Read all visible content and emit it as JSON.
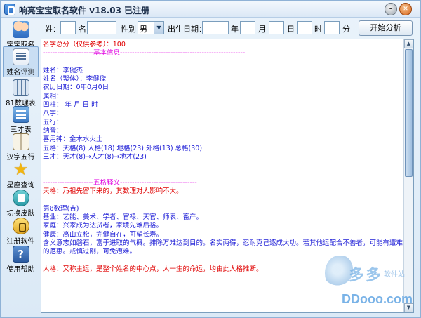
{
  "window": {
    "title": "响亮宝宝取名软件  v18.03   已注册",
    "minimize_glyph": "–",
    "close_glyph": "✕"
  },
  "sidebar": {
    "items": [
      {
        "label": "宝宝取名",
        "icon": "baby-icon"
      },
      {
        "label": "姓名评测",
        "icon": "name-eval-icon",
        "active": true
      },
      {
        "label": "81数理表",
        "icon": "grid-table-icon"
      },
      {
        "label": "三才表",
        "icon": "sancai-table-icon"
      },
      {
        "label": "汉字五行",
        "icon": "book-icon"
      },
      {
        "label": "星座查询",
        "icon": "star-icon"
      },
      {
        "label": "切换皮肤",
        "icon": "tshirt-icon"
      },
      {
        "label": "注册软件",
        "icon": "key-icon"
      },
      {
        "label": "使用帮助",
        "icon": "help-icon"
      }
    ]
  },
  "form": {
    "surname_label": "姓：",
    "surname_value": "",
    "given_label": "名",
    "given_value": "",
    "gender_label": "性别",
    "gender_value": "男",
    "birthdate_label": "出生日期：",
    "year_label": "年",
    "month_label": "月",
    "day_label": "日",
    "hour_label": "时",
    "minute_label": "分",
    "analyze_button": "开始分析"
  },
  "result": {
    "score_line": "名字总分（仅供参考）：100",
    "basic_header": "---------------------基本信息----------------------------------------------------",
    "name_simplified": "姓名：李健杰",
    "name_traditional": "姓名（繁体）：李健傑",
    "lunar_date": "农历日期：0年0月0日",
    "zodiac": "属相：",
    "four_pillars": "四柱： 年  月  日  时",
    "bazi": "八字：",
    "wuxing": "五行：",
    "nayin": "纳音：",
    "xiyongshen": "喜用神：金木水火土",
    "wuge": "五格：天格(8)  人格(18)  地格(23)  外格(13)  总格(30)",
    "sancai": "三才：天才(8)→人才(8)→地才(23)",
    "wuge_header": "---------------------五格释义--------------------------------",
    "tiange_explain": "天格：乃祖先留下来的，其数理对人影响不大。",
    "shuli_title": "第8数理(吉)",
    "jiye": "基业：艺能、美术、学者、官禄、天官、师表、畜产。",
    "jiating": "家庭：兴家成为达货者，家境先难后裕。",
    "jiankang": "健康：高山立松，完健自在，可望长寿。",
    "hanyi_1": "含义意志如磐石，富于进取的气概。排除万难达到目的。名实两得，忍耐克己逐成大功。若其他运配合不善者，可能有遭难",
    "hanyi_2": "的厄惠。戒慎过刚，可免遭难。",
    "renge_explain": "人格：又称主运，是整个姓名的中心点，人一生的命运，均由此人格推断。"
  },
  "watermark": {
    "brand_cn": "多多",
    "brand_sub": "软件站",
    "domain": "DDooo.com"
  }
}
